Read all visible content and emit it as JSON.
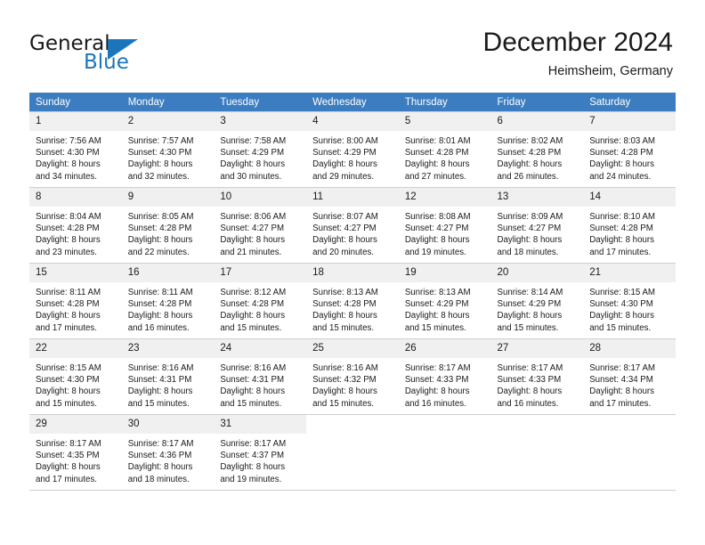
{
  "brand": {
    "name_top": "General",
    "name_bottom": "Blue",
    "accent_color": "#1b75bb"
  },
  "header": {
    "title": "December 2024",
    "subtitle": "Heimsheim, Germany"
  },
  "calendar": {
    "header_bg": "#3b7dc0",
    "daynum_bg": "#f0f0f0",
    "grid_line_color": "#cfcfcf",
    "weekday_headers": [
      "Sunday",
      "Monday",
      "Tuesday",
      "Wednesday",
      "Thursday",
      "Friday",
      "Saturday"
    ],
    "weeks": [
      [
        {
          "day": "1",
          "sunrise": "Sunrise: 7:56 AM",
          "sunset": "Sunset: 4:30 PM",
          "daylight_line1": "Daylight: 8 hours",
          "daylight_line2": "and 34 minutes."
        },
        {
          "day": "2",
          "sunrise": "Sunrise: 7:57 AM",
          "sunset": "Sunset: 4:30 PM",
          "daylight_line1": "Daylight: 8 hours",
          "daylight_line2": "and 32 minutes."
        },
        {
          "day": "3",
          "sunrise": "Sunrise: 7:58 AM",
          "sunset": "Sunset: 4:29 PM",
          "daylight_line1": "Daylight: 8 hours",
          "daylight_line2": "and 30 minutes."
        },
        {
          "day": "4",
          "sunrise": "Sunrise: 8:00 AM",
          "sunset": "Sunset: 4:29 PM",
          "daylight_line1": "Daylight: 8 hours",
          "daylight_line2": "and 29 minutes."
        },
        {
          "day": "5",
          "sunrise": "Sunrise: 8:01 AM",
          "sunset": "Sunset: 4:28 PM",
          "daylight_line1": "Daylight: 8 hours",
          "daylight_line2": "and 27 minutes."
        },
        {
          "day": "6",
          "sunrise": "Sunrise: 8:02 AM",
          "sunset": "Sunset: 4:28 PM",
          "daylight_line1": "Daylight: 8 hours",
          "daylight_line2": "and 26 minutes."
        },
        {
          "day": "7",
          "sunrise": "Sunrise: 8:03 AM",
          "sunset": "Sunset: 4:28 PM",
          "daylight_line1": "Daylight: 8 hours",
          "daylight_line2": "and 24 minutes."
        }
      ],
      [
        {
          "day": "8",
          "sunrise": "Sunrise: 8:04 AM",
          "sunset": "Sunset: 4:28 PM",
          "daylight_line1": "Daylight: 8 hours",
          "daylight_line2": "and 23 minutes."
        },
        {
          "day": "9",
          "sunrise": "Sunrise: 8:05 AM",
          "sunset": "Sunset: 4:28 PM",
          "daylight_line1": "Daylight: 8 hours",
          "daylight_line2": "and 22 minutes."
        },
        {
          "day": "10",
          "sunrise": "Sunrise: 8:06 AM",
          "sunset": "Sunset: 4:27 PM",
          "daylight_line1": "Daylight: 8 hours",
          "daylight_line2": "and 21 minutes."
        },
        {
          "day": "11",
          "sunrise": "Sunrise: 8:07 AM",
          "sunset": "Sunset: 4:27 PM",
          "daylight_line1": "Daylight: 8 hours",
          "daylight_line2": "and 20 minutes."
        },
        {
          "day": "12",
          "sunrise": "Sunrise: 8:08 AM",
          "sunset": "Sunset: 4:27 PM",
          "daylight_line1": "Daylight: 8 hours",
          "daylight_line2": "and 19 minutes."
        },
        {
          "day": "13",
          "sunrise": "Sunrise: 8:09 AM",
          "sunset": "Sunset: 4:27 PM",
          "daylight_line1": "Daylight: 8 hours",
          "daylight_line2": "and 18 minutes."
        },
        {
          "day": "14",
          "sunrise": "Sunrise: 8:10 AM",
          "sunset": "Sunset: 4:28 PM",
          "daylight_line1": "Daylight: 8 hours",
          "daylight_line2": "and 17 minutes."
        }
      ],
      [
        {
          "day": "15",
          "sunrise": "Sunrise: 8:11 AM",
          "sunset": "Sunset: 4:28 PM",
          "daylight_line1": "Daylight: 8 hours",
          "daylight_line2": "and 17 minutes."
        },
        {
          "day": "16",
          "sunrise": "Sunrise: 8:11 AM",
          "sunset": "Sunset: 4:28 PM",
          "daylight_line1": "Daylight: 8 hours",
          "daylight_line2": "and 16 minutes."
        },
        {
          "day": "17",
          "sunrise": "Sunrise: 8:12 AM",
          "sunset": "Sunset: 4:28 PM",
          "daylight_line1": "Daylight: 8 hours",
          "daylight_line2": "and 15 minutes."
        },
        {
          "day": "18",
          "sunrise": "Sunrise: 8:13 AM",
          "sunset": "Sunset: 4:28 PM",
          "daylight_line1": "Daylight: 8 hours",
          "daylight_line2": "and 15 minutes."
        },
        {
          "day": "19",
          "sunrise": "Sunrise: 8:13 AM",
          "sunset": "Sunset: 4:29 PM",
          "daylight_line1": "Daylight: 8 hours",
          "daylight_line2": "and 15 minutes."
        },
        {
          "day": "20",
          "sunrise": "Sunrise: 8:14 AM",
          "sunset": "Sunset: 4:29 PM",
          "daylight_line1": "Daylight: 8 hours",
          "daylight_line2": "and 15 minutes."
        },
        {
          "day": "21",
          "sunrise": "Sunrise: 8:15 AM",
          "sunset": "Sunset: 4:30 PM",
          "daylight_line1": "Daylight: 8 hours",
          "daylight_line2": "and 15 minutes."
        }
      ],
      [
        {
          "day": "22",
          "sunrise": "Sunrise: 8:15 AM",
          "sunset": "Sunset: 4:30 PM",
          "daylight_line1": "Daylight: 8 hours",
          "daylight_line2": "and 15 minutes."
        },
        {
          "day": "23",
          "sunrise": "Sunrise: 8:16 AM",
          "sunset": "Sunset: 4:31 PM",
          "daylight_line1": "Daylight: 8 hours",
          "daylight_line2": "and 15 minutes."
        },
        {
          "day": "24",
          "sunrise": "Sunrise: 8:16 AM",
          "sunset": "Sunset: 4:31 PM",
          "daylight_line1": "Daylight: 8 hours",
          "daylight_line2": "and 15 minutes."
        },
        {
          "day": "25",
          "sunrise": "Sunrise: 8:16 AM",
          "sunset": "Sunset: 4:32 PM",
          "daylight_line1": "Daylight: 8 hours",
          "daylight_line2": "and 15 minutes."
        },
        {
          "day": "26",
          "sunrise": "Sunrise: 8:17 AM",
          "sunset": "Sunset: 4:33 PM",
          "daylight_line1": "Daylight: 8 hours",
          "daylight_line2": "and 16 minutes."
        },
        {
          "day": "27",
          "sunrise": "Sunrise: 8:17 AM",
          "sunset": "Sunset: 4:33 PM",
          "daylight_line1": "Daylight: 8 hours",
          "daylight_line2": "and 16 minutes."
        },
        {
          "day": "28",
          "sunrise": "Sunrise: 8:17 AM",
          "sunset": "Sunset: 4:34 PM",
          "daylight_line1": "Daylight: 8 hours",
          "daylight_line2": "and 17 minutes."
        }
      ],
      [
        {
          "day": "29",
          "sunrise": "Sunrise: 8:17 AM",
          "sunset": "Sunset: 4:35 PM",
          "daylight_line1": "Daylight: 8 hours",
          "daylight_line2": "and 17 minutes."
        },
        {
          "day": "30",
          "sunrise": "Sunrise: 8:17 AM",
          "sunset": "Sunset: 4:36 PM",
          "daylight_line1": "Daylight: 8 hours",
          "daylight_line2": "and 18 minutes."
        },
        {
          "day": "31",
          "sunrise": "Sunrise: 8:17 AM",
          "sunset": "Sunset: 4:37 PM",
          "daylight_line1": "Daylight: 8 hours",
          "daylight_line2": "and 19 minutes."
        },
        {
          "day": "",
          "sunrise": "",
          "sunset": "",
          "daylight_line1": "",
          "daylight_line2": ""
        },
        {
          "day": "",
          "sunrise": "",
          "sunset": "",
          "daylight_line1": "",
          "daylight_line2": ""
        },
        {
          "day": "",
          "sunrise": "",
          "sunset": "",
          "daylight_line1": "",
          "daylight_line2": ""
        },
        {
          "day": "",
          "sunrise": "",
          "sunset": "",
          "daylight_line1": "",
          "daylight_line2": ""
        }
      ]
    ]
  }
}
